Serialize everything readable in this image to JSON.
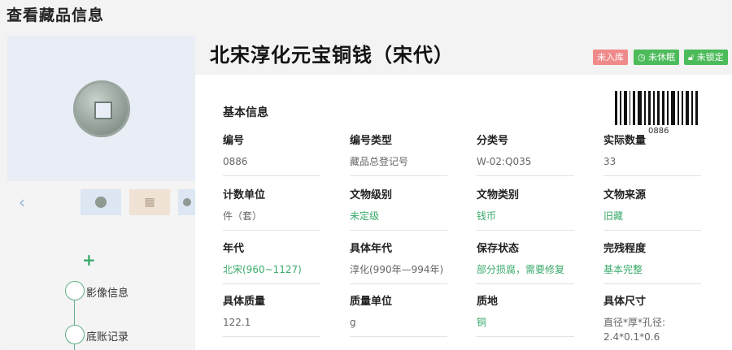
{
  "page_title": "查看藏品信息",
  "item_title": "北宋淳化元宝铜钱（宋代）",
  "badges": {
    "storage": "未入库",
    "dormant": "未休眠",
    "lock": "未锁定"
  },
  "colors": {
    "badge_red": "#f08a8a",
    "badge_green": "#4cbb5a",
    "value_green": "#3aaa6a"
  },
  "thumbs": {
    "prev_arrow": "‹"
  },
  "timeline": [
    "影像信息",
    "底账记录"
  ],
  "section_title": "基本信息",
  "barcode_number": "0886",
  "fields": [
    {
      "label": "编号",
      "value": "0886",
      "green": false
    },
    {
      "label": "编号类型",
      "value": "藏品总登记号",
      "green": false
    },
    {
      "label": "分类号",
      "value": "W-02:Q035",
      "green": false
    },
    {
      "label": "实际数量",
      "value": "33",
      "green": false
    },
    {
      "label": "计数单位",
      "value": "件（套）",
      "green": false
    },
    {
      "label": "文物级别",
      "value": "未定级",
      "green": true
    },
    {
      "label": "文物类别",
      "value": "钱币",
      "green": true
    },
    {
      "label": "文物来源",
      "value": "旧藏",
      "green": true
    },
    {
      "label": "年代",
      "value": "北宋(960~1127)",
      "green": true
    },
    {
      "label": "具体年代",
      "value": "淳化(990年—994年)",
      "green": false
    },
    {
      "label": "保存状态",
      "value": "部分损腐，需要修复",
      "green": true
    },
    {
      "label": "完残程度",
      "value": "基本完整",
      "green": true
    },
    {
      "label": "具体质量",
      "value": "122.1",
      "green": false
    },
    {
      "label": "质量单位",
      "value": "g",
      "green": false
    },
    {
      "label": "质地",
      "value": "铜",
      "green": true
    },
    {
      "label": "具体尺寸",
      "value": "直径*厚*孔径: 2.4*0.1*0.6",
      "green": false
    }
  ]
}
